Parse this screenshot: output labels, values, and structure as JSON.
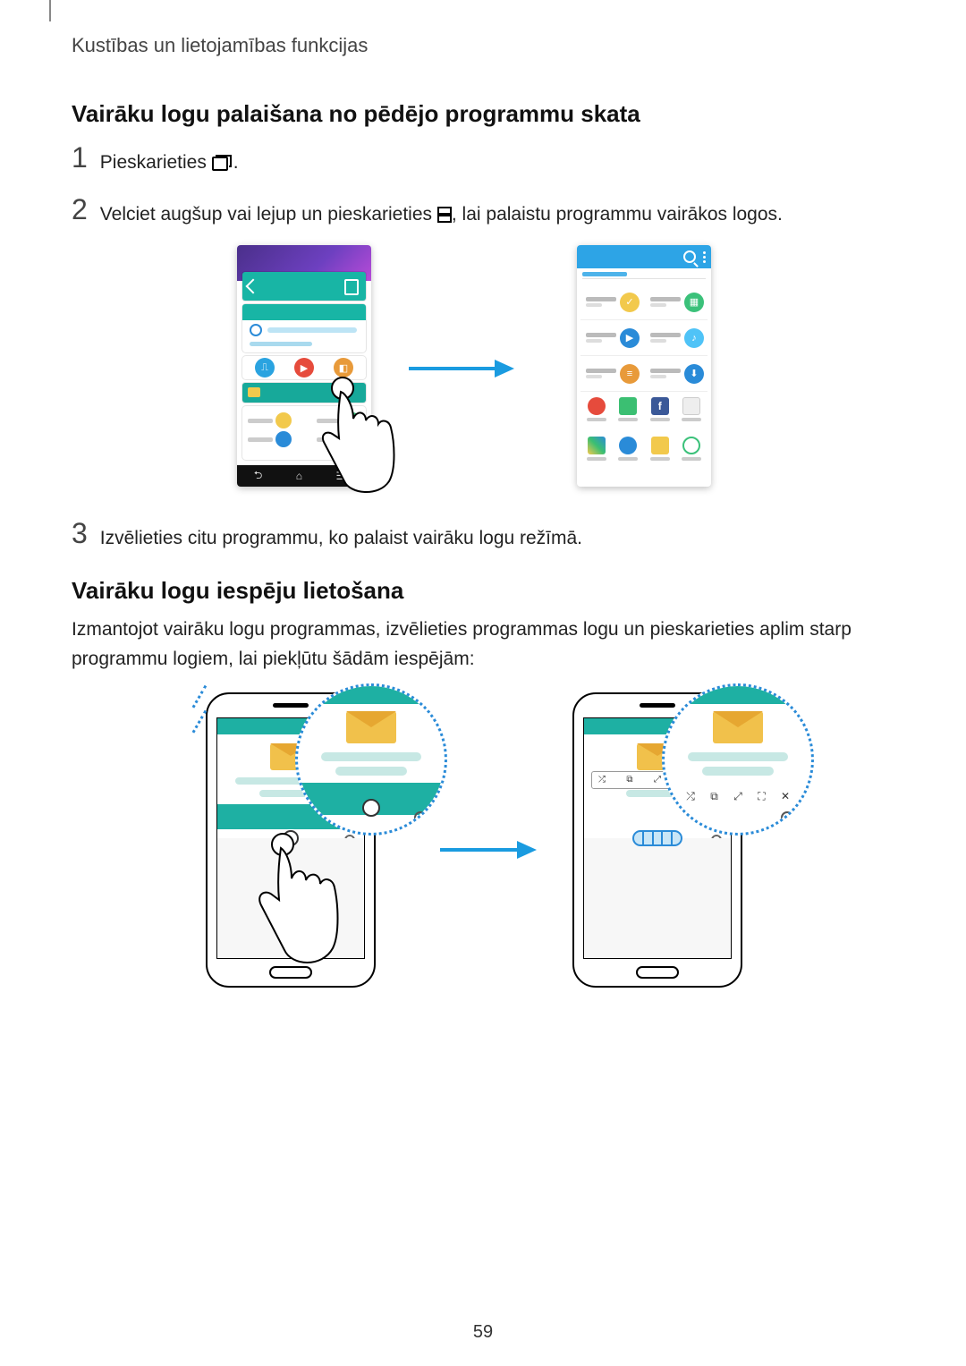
{
  "header": {
    "breadcrumb": "Kustības un lietojamības funkcijas"
  },
  "section1": {
    "heading": "Vairāku logu palaišana no pēdējo programmu skata",
    "steps": {
      "s1": {
        "num": "1",
        "text_a": "Pieskarieties ",
        "text_b": "."
      },
      "s2": {
        "num": "2",
        "text_a": "Velciet augšup vai lejup un pieskarieties ",
        "text_b": ", lai palaistu programmu vairākos logos."
      },
      "s3": {
        "num": "3",
        "text": "Izvēlieties citu programmu, ko palaist vairāku logu režīmā."
      }
    }
  },
  "section2": {
    "heading": "Vairāku logu iespēju lietošana",
    "paragraph": "Izmantojot vairāku logu programmas, izvēlieties programmas logu un pieskarieties aplim starp programmu logiem, lai piekļūtu šādām iespējām:"
  },
  "icons": {
    "recent_apps": "recent-apps-icon",
    "multiwindow": "multiwindow-icon",
    "search": "Q",
    "more": "⋮"
  },
  "page_number": "59"
}
